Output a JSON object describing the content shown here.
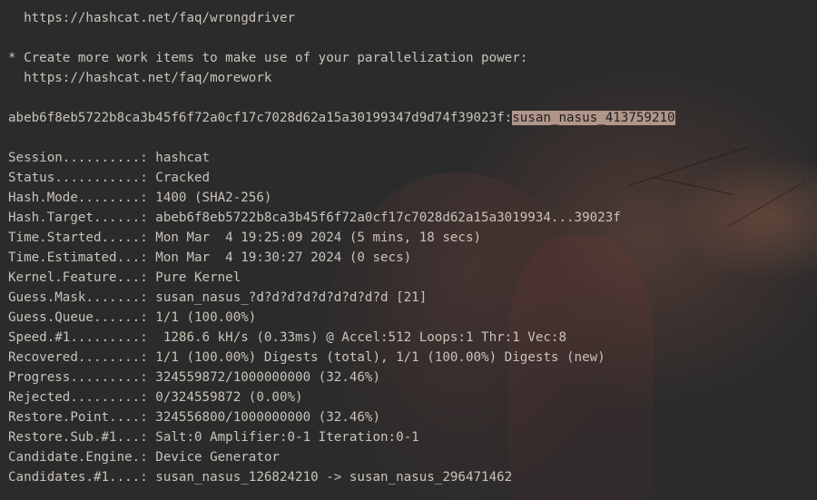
{
  "intro_lines": [
    "  https://hashcat.net/faq/wrongdriver",
    "",
    "* Create more work items to make use of your parallelization power:",
    "  https://hashcat.net/faq/morework"
  ],
  "cracked": {
    "hash": "abeb6f8eb5722b8ca3b45f6f72a0cf17c7028d62a15a30199347d9d74f39023f:",
    "password": "susan_nasus_413759210"
  },
  "status_rows": [
    {
      "key": "Session..........: ",
      "value": "hashcat"
    },
    {
      "key": "Status...........: ",
      "value": "Cracked"
    },
    {
      "key": "Hash.Mode........: ",
      "value": "1400 (SHA2-256)"
    },
    {
      "key": "Hash.Target......: ",
      "value": "abeb6f8eb5722b8ca3b45f6f72a0cf17c7028d62a15a3019934...39023f"
    },
    {
      "key": "Time.Started.....: ",
      "value": "Mon Mar  4 19:25:09 2024 (5 mins, 18 secs)"
    },
    {
      "key": "Time.Estimated...: ",
      "value": "Mon Mar  4 19:30:27 2024 (0 secs)"
    },
    {
      "key": "Kernel.Feature...: ",
      "value": "Pure Kernel"
    },
    {
      "key": "Guess.Mask.......: ",
      "value": "susan_nasus_?d?d?d?d?d?d?d?d?d [21]"
    },
    {
      "key": "Guess.Queue......: ",
      "value": "1/1 (100.00%)"
    },
    {
      "key": "Speed.#1.........: ",
      "value": " 1286.6 kH/s (0.33ms) @ Accel:512 Loops:1 Thr:1 Vec:8"
    },
    {
      "key": "Recovered........: ",
      "value": "1/1 (100.00%) Digests (total), 1/1 (100.00%) Digests (new)"
    },
    {
      "key": "Progress.........: ",
      "value": "324559872/1000000000 (32.46%)"
    },
    {
      "key": "Rejected.........: ",
      "value": "0/324559872 (0.00%)"
    },
    {
      "key": "Restore.Point....: ",
      "value": "324556800/1000000000 (32.46%)"
    },
    {
      "key": "Restore.Sub.#1...: ",
      "value": "Salt:0 Amplifier:0-1 Iteration:0-1"
    },
    {
      "key": "Candidate.Engine.: ",
      "value": "Device Generator"
    },
    {
      "key": "Candidates.#1....: ",
      "value": "susan_nasus_126824210 -> susan_nasus_296471462"
    }
  ],
  "colors": {
    "text": "#c9c3b8",
    "background": "#2b2b2c",
    "selection": "#b0968a"
  }
}
